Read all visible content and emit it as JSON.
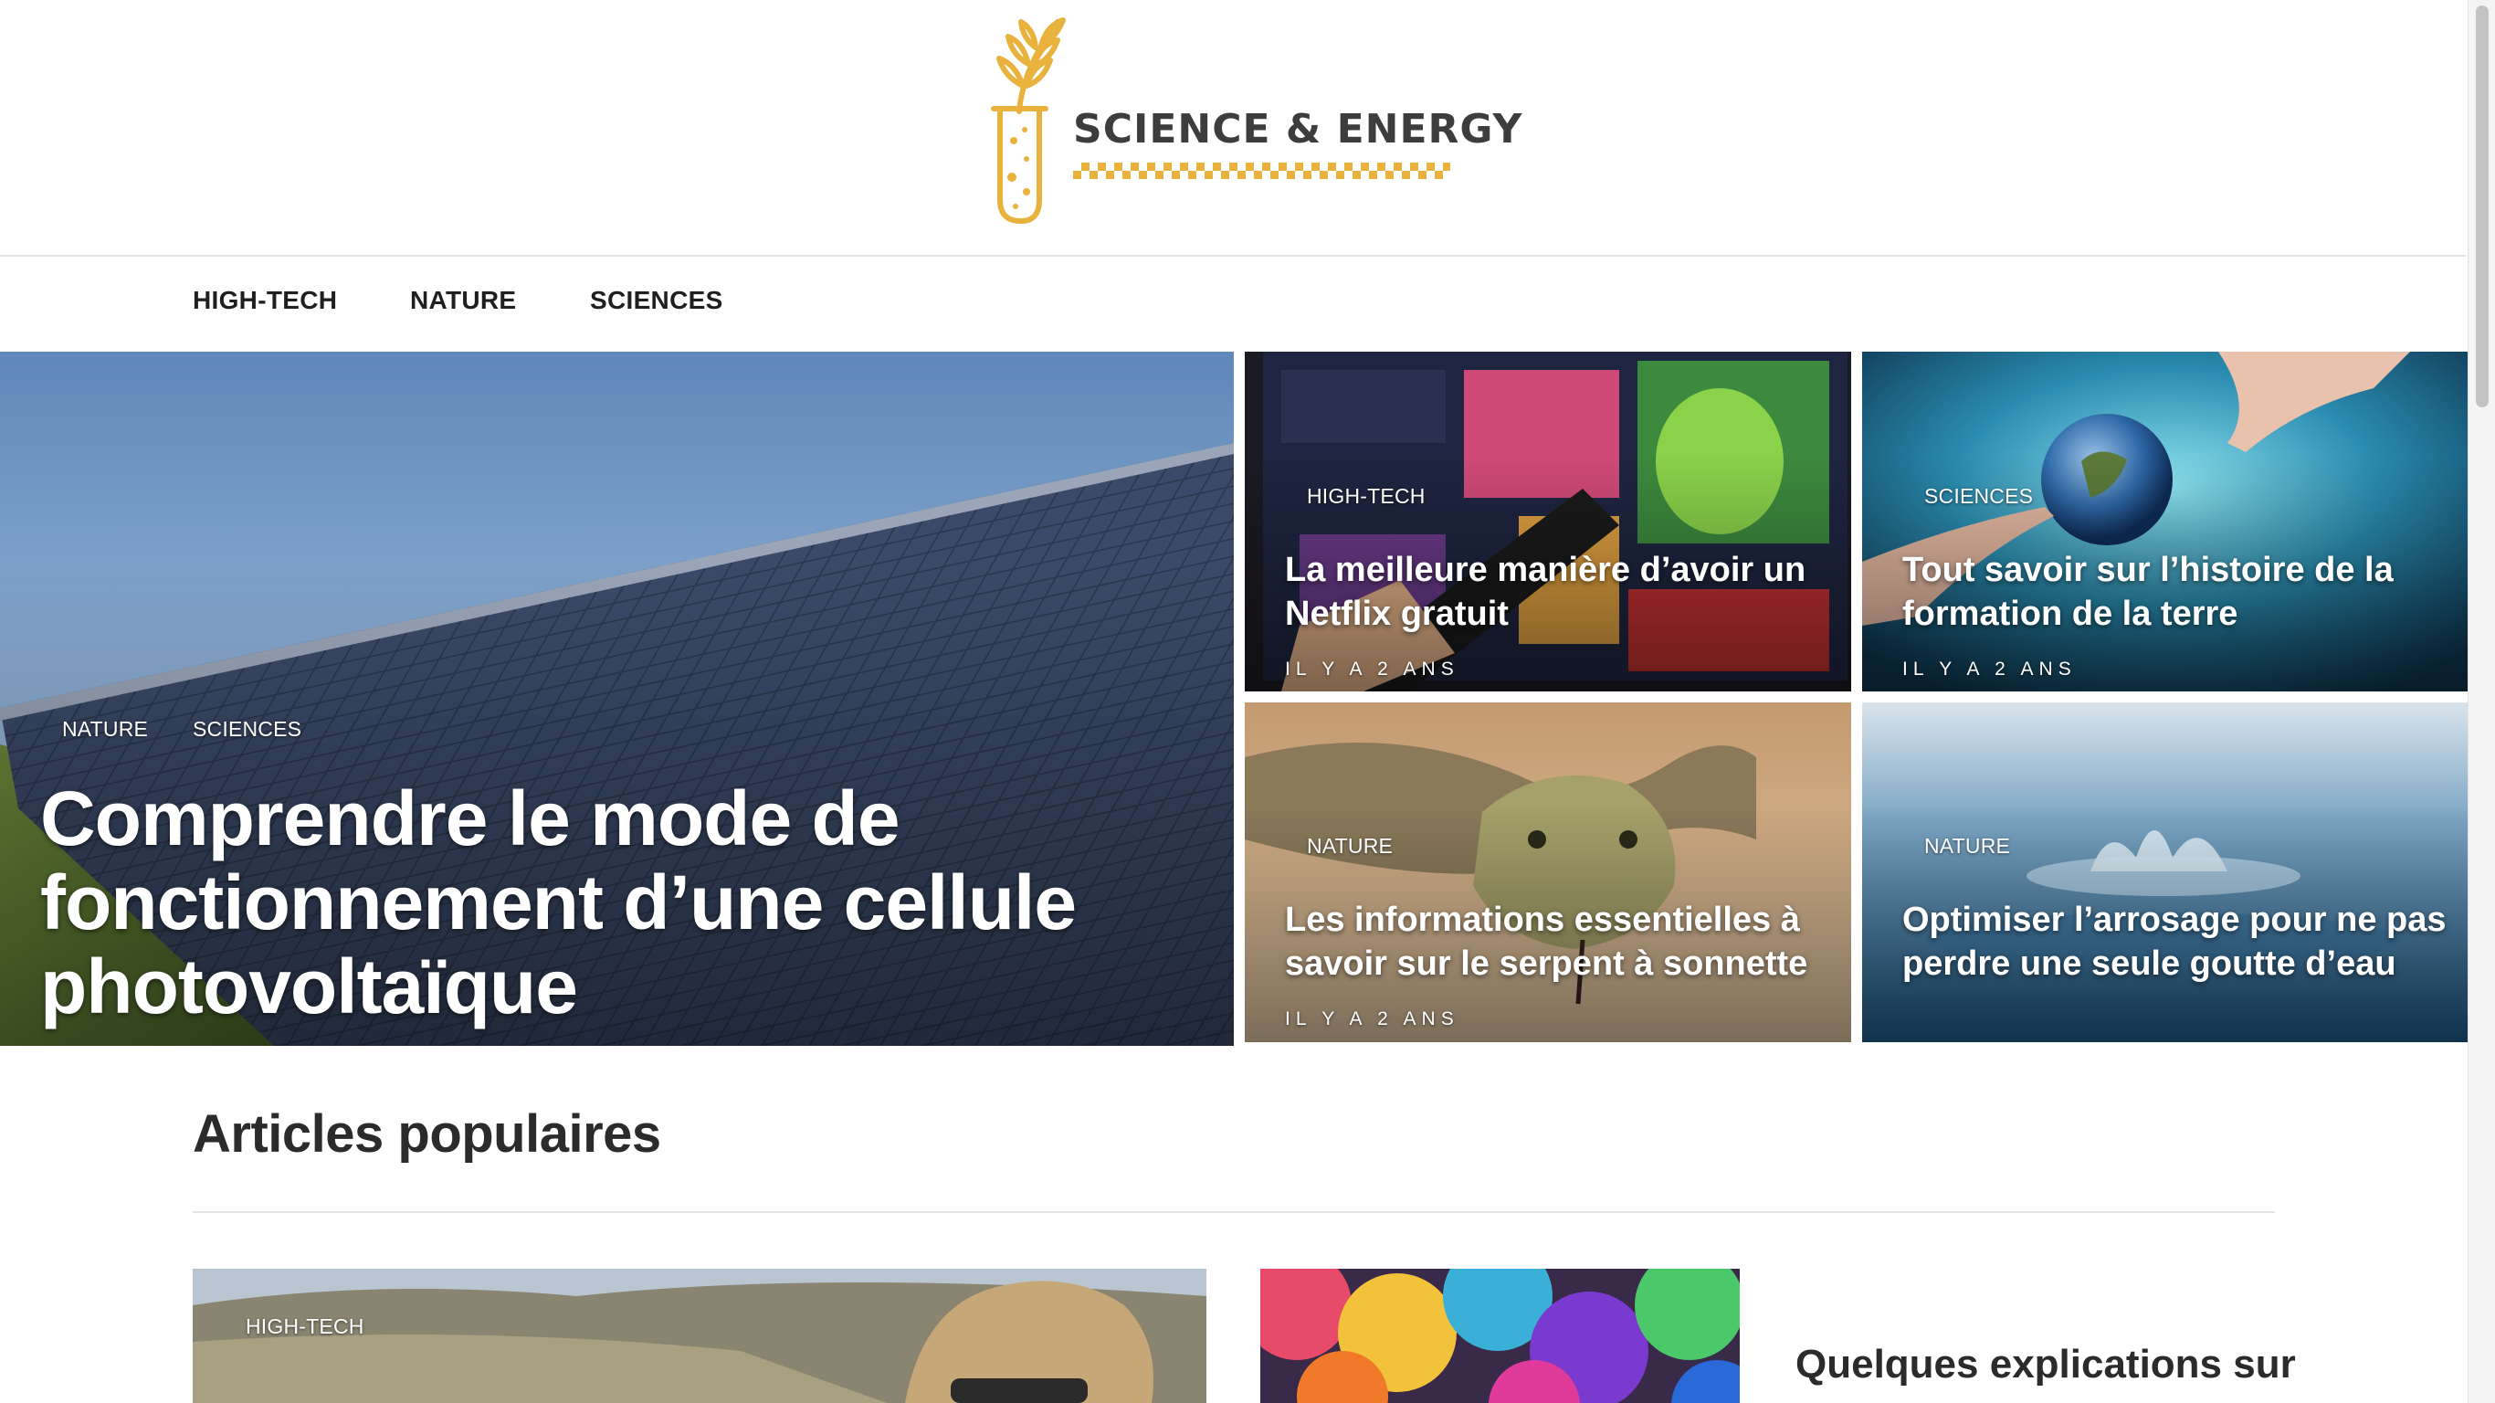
{
  "site": {
    "logo_text": "SCIENCE & ENERGY",
    "brand_color": "#E8B23D"
  },
  "nav": {
    "items": [
      "HIGH-TECH",
      "NATURE",
      "SCIENCES"
    ]
  },
  "hero": {
    "main": {
      "categories": [
        "NATURE",
        "SCIENCES"
      ],
      "title": "Comprendre le mode de fonctionnement d’une cellule photovoltaïque",
      "image": "solar-panels-photo"
    },
    "cards": [
      {
        "category": "HIGH-TECH",
        "title": "La meilleure manière d’avoir un Netflix gratuit",
        "date": "IL Y A 2 ANS",
        "image": "tv-remote-netflix-photo"
      },
      {
        "category": "SCIENCES",
        "title": "Tout savoir sur l’histoire de la formation de la terre",
        "date": "IL Y A 2 ANS",
        "image": "earth-hands-photo"
      },
      {
        "category": "NATURE",
        "title": "Les informations essentielles à savoir sur le serpent à sonnette",
        "date": "IL Y A 2 ANS",
        "image": "rattlesnake-photo"
      },
      {
        "category": "NATURE",
        "title": "Optimiser l’arrosage pour ne pas perdre une seule goutte d’eau",
        "date": "",
        "image": "water-drop-photo"
      }
    ]
  },
  "popular": {
    "heading": "Articles populaires",
    "first_card": {
      "category": "HIGH-TECH",
      "image": "man-sunglasses-photo"
    },
    "second_card": {
      "image": "rainbow-roses-photo"
    },
    "side_title": "Quelques explications sur"
  }
}
